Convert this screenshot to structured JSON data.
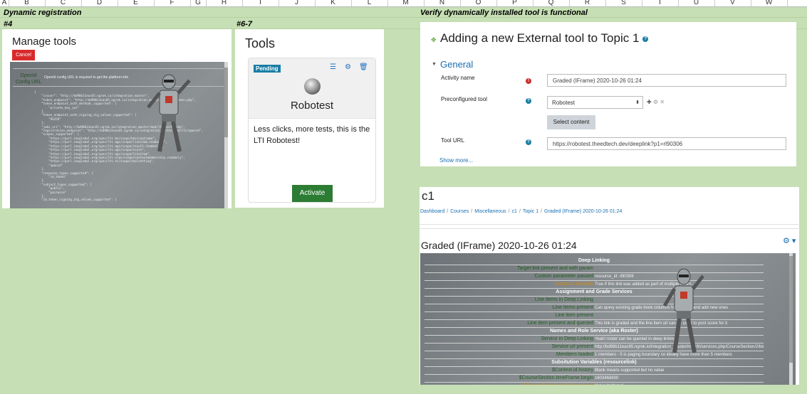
{
  "spreadsheet": {
    "columns": [
      "A",
      "B",
      "C",
      "D",
      "E",
      "F",
      "G",
      "H",
      "I",
      "J",
      "K",
      "L",
      "M",
      "N",
      "O",
      "P",
      "Q",
      "R",
      "S",
      "T",
      "U",
      "V",
      "W"
    ],
    "dynamic_registration": "Dynamic registration",
    "step4": "#4",
    "step67": "#6-7",
    "verify_heading": "Verify dynamically installed tool is functional"
  },
  "manage_tools": {
    "title": "Manage tools",
    "cancel_label": "Cancel",
    "openid_label": "OpenId Config URL",
    "openid_message": "OpenId config URL is required to get the platform info",
    "config_json": "{\n    \"issuer\": \"http://bd98b11eac65.ngrok.io/integration_master\",\n    \"token_endpoint\": \"http://bd98b11eac65.ngrok.io/integration_master/mod/lti/token.php\",\n    \"token_endpoint_auth_methods_supported\": [\n        \"private_key_jwt\"\n    ],\n    \"token_endpoint_auth_signing_alg_values_supported\": [\n        \"RS256\"\n    ],\n    \"jwks_uri\": \"http://bd98b11eac65.ngrok.io/integration_master/mod/lti/certs.php\",\n    \"registration_endpoint\": \"http://bd98b11eac65.ngrok.io/integration_master/mod/lti/openid\",\n    \"scopes_supported\": [\n        \"https://purl.imsglobal.org/spec/lti-bo/scope/basicoutcome\",\n        \"https://purl.imsglobal.org/spec/lti-ags/scope/lineitem.readonly\",\n        \"https://purl.imsglobal.org/spec/lti-ags/scope/result.readonly\",\n        \"https://purl.imsglobal.org/spec/lti-ags/scope/score\",\n        \"https://purl.imsglobal.org/spec/lti-ags/scope/lineitem\",\n        \"https://purl.imsglobal.org/spec/lti-nrps/scope/contextmembership.readonly\",\n        \"https://purl.imsglobal.org/spec/lti-ts/scope/toolsetting\",\n        \"openid\"\n    ],\n    \"response_types_supported\": [\n        \"id_token\"\n    ],\n    \"subject_types_supported\": [\n        \"public\",\n        \"pairwise\"\n    ],\n    \"id_token_signing_alg_values_supported\": ["
  },
  "tools": {
    "title": "Tools",
    "status_badge": "Pending",
    "tool_name": "Robotest",
    "description": "Less clicks, more tests, this is the LTI Robotest!",
    "activate_label": "Activate"
  },
  "add_tool": {
    "title": "Adding a new External tool to Topic 1",
    "section": "General",
    "activity_name_label": "Activity name",
    "activity_name_value": "Graded (IFrame) 2020-10-26 01:24",
    "preconfigured_label": "Preconfigured tool",
    "preconfigured_value": "Robotest",
    "select_content_label": "Select content",
    "tool_url_label": "Tool URL",
    "tool_url_value": "https://robotest.theedtech.dev/deeplink?p1=rl90306",
    "show_more": "Show more..."
  },
  "course": {
    "title": "c1",
    "breadcrumb": [
      "Dashboard",
      "Courses",
      "Miscellaneous",
      "c1",
      "Topic 1",
      "Graded (IFrame) 2020-10-26 01:24"
    ],
    "activity_title": "Graded (IFrame) 2020-10-26 01:24",
    "rows": [
      {
        "type": "header",
        "text": "Deep Linking"
      },
      {
        "key": "Target link present and with param",
        "value": ""
      },
      {
        "key": "Custom parameter passed",
        "value": "resource_id: rl90306"
      },
      {
        "key": "Supports Multiple",
        "value": "True if this link was added as part of multiple return.",
        "orange": true
      },
      {
        "type": "header",
        "text": "Assignment and Grade Services"
      },
      {
        "key": "Line items in Deep Linking",
        "value": ""
      },
      {
        "key": "Line items present",
        "value": "Can query existing grade book columns for this tool and add new ones"
      },
      {
        "key": "Line item present",
        "value": ""
      },
      {
        "key": "Line item present and queried",
        "value": "This link is graded and the line item url can be used to post score for it"
      },
      {
        "type": "header",
        "text": "Names and Role Service (aka Roster)"
      },
      {
        "key": "Service in Deep Linking",
        "value": "Yeah! roster can be queried in deep linking"
      },
      {
        "key": "Service url present",
        "value": "http://bd98b11eac65.ngrok.io/integration_master/mod/lti/services.php/CourseSection/2/bindings/1/memberships"
      },
      {
        "key": "Members loaded",
        "value": "1 members - 5 is paging boundary so ideally have more than 5 members"
      },
      {
        "type": "header",
        "text": "Subsitution Variables (resourcelink)"
      },
      {
        "key": "$Context.id.history",
        "value": "Blank means supported but no value"
      },
      {
        "key": "$CourseSection.timeFrame.begin",
        "value": "1603468800"
      },
      {
        "key": "$CourseSection.timeFrame.end",
        "value": "Not substituted",
        "orange": true
      }
    ]
  },
  "colors": {
    "sheet_bg": "#c6dfb4",
    "cancel": "#d9292b",
    "pending": "#1a7ea6",
    "activate": "#2c7c34",
    "link": "#1a6fb0"
  }
}
